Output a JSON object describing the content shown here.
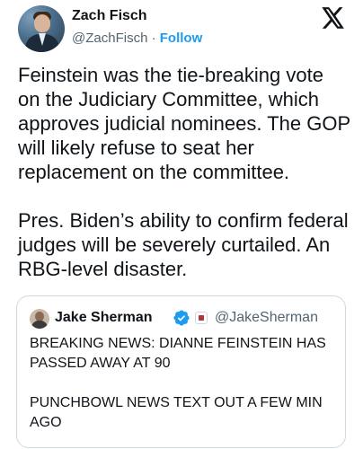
{
  "author": {
    "display_name": "Zach Fisch",
    "handle": "@ZachFisch",
    "separator": "·",
    "follow_label": "Follow",
    "avatar_icon": "profile-photo"
  },
  "platform": {
    "logo_icon": "x-logo-icon"
  },
  "tweet": {
    "paragraphs": [
      "Feinstein was the tie-breaking vote on the Judiciary Committee, which approves judicial nominees. The GOP will likely refuse to seat her replacement on the committee.",
      "Pres. Biden’s ability to confirm federal judges will be severely curtailed. An RBG-level disaster."
    ]
  },
  "quoted_tweet": {
    "display_name": "Jake Sherman",
    "handle": "@JakeSherman",
    "verified_icon": "verified-badge-icon",
    "affiliate_icon": "affiliate-badge-icon",
    "verified_color": "#1d9bf0",
    "paragraphs": [
      "BREAKING NEWS: DIANNE FEINSTEIN HAS PASSED AWAY AT 90",
      "PUNCHBOWL NEWS TEXT OUT A FEW MIN AGO"
    ]
  },
  "colors": {
    "text": "#0f1419",
    "secondary": "#536471",
    "accent": "#1d9bf0",
    "border": "#cfd9de"
  }
}
